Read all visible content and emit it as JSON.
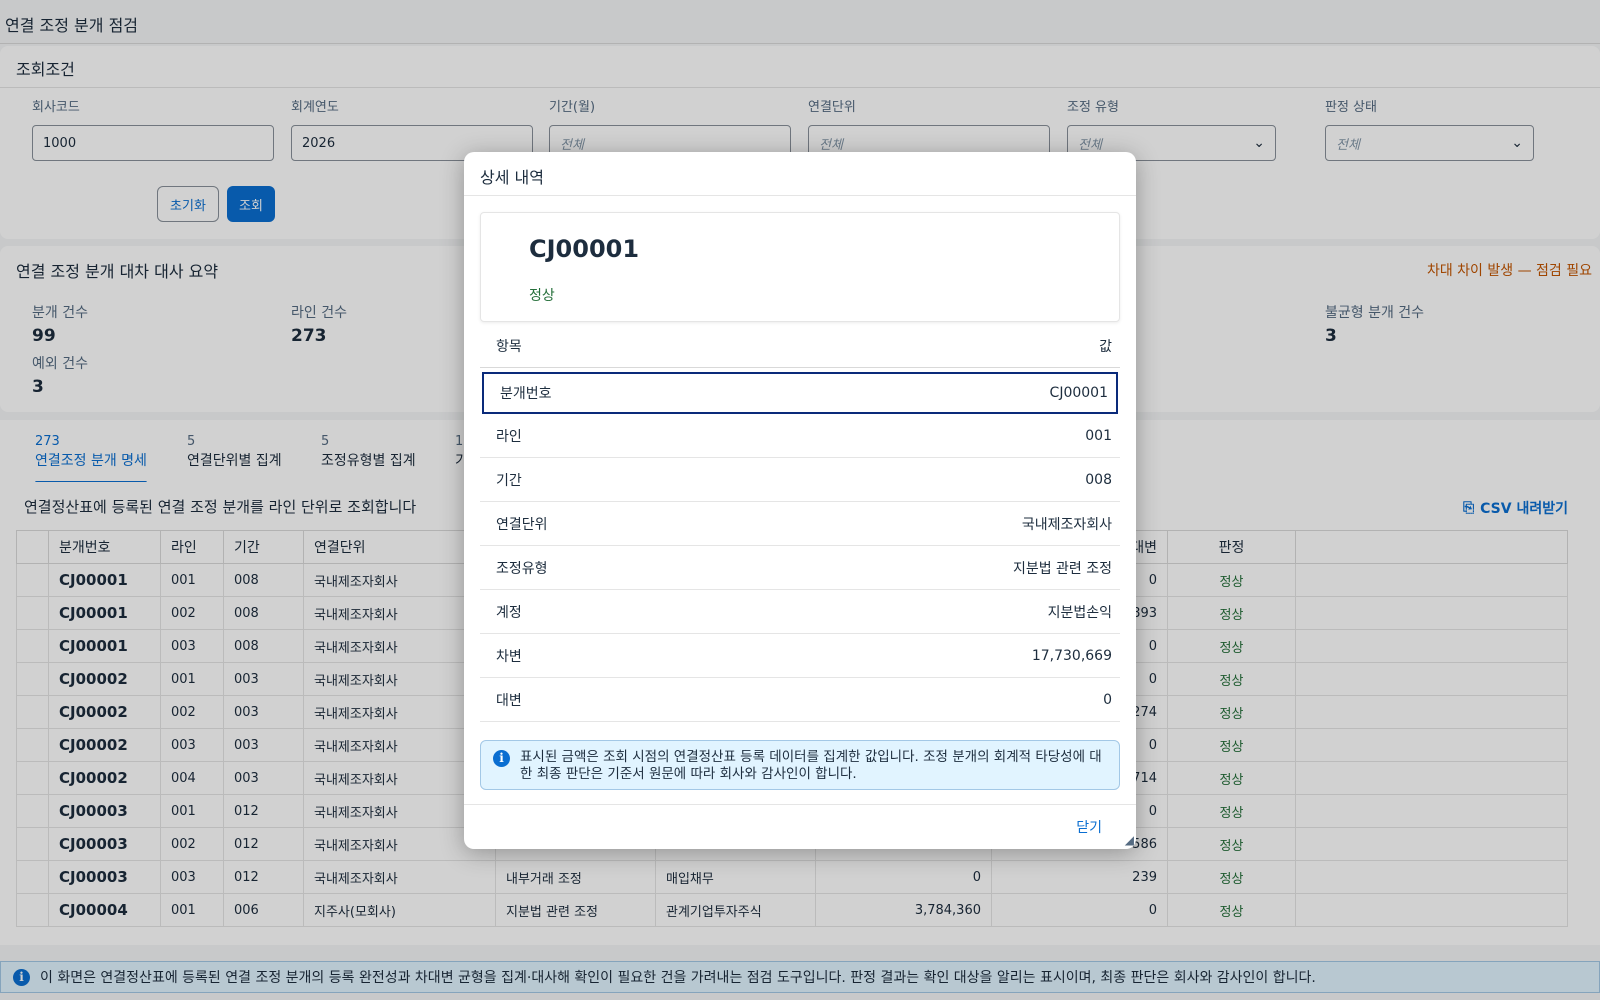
{
  "page": {
    "title": "연결 조정 분개 점검"
  },
  "filters": {
    "header": "조회조건",
    "fields": [
      {
        "label": "회사코드",
        "value": "1000",
        "placeholder": ""
      },
      {
        "label": "회계연도",
        "value": "2026",
        "placeholder": ""
      },
      {
        "label": "기간(월)",
        "value": "",
        "placeholder": "전체"
      },
      {
        "label": "연결단위",
        "value": "",
        "placeholder": "전체"
      },
      {
        "label": "조정 유형",
        "value": "",
        "placeholder": "전체"
      },
      {
        "label": "판정 상태",
        "value": "",
        "placeholder": "전체"
      }
    ],
    "reset_label": "초기화",
    "search_label": "조회"
  },
  "summary": {
    "title": "연결 조정 분개 대차 대사 요약",
    "warning": "차대 차이 발생 — 점검 필요",
    "stats": [
      {
        "label": "분개 건수",
        "value": "99"
      },
      {
        "label": "라인 건수",
        "value": "273"
      },
      {
        "label": "불균형 분개 건수",
        "value": "3"
      },
      {
        "label": "예외 건수",
        "value": "3"
      }
    ]
  },
  "tabs": [
    {
      "count": "273",
      "label": "연결조정 분개 명세"
    },
    {
      "count": "5",
      "label": "연결단위별 집계"
    },
    {
      "count": "5",
      "label": "조정유형별 집계"
    },
    {
      "count": "1",
      "label": "기"
    }
  ],
  "table": {
    "caption": "연결정산표에 등록된 연결 조정 분개를 라인 단위로 조회합니다",
    "csv_label": "CSV 내려받기",
    "columns": [
      "분개번호",
      "라인",
      "기간",
      "연결단위",
      "",
      "",
      "",
      "대변",
      "판정"
    ],
    "rows": [
      [
        "CJ00001",
        "001",
        "008",
        "국내제조자회사",
        "",
        "",
        "",
        "0",
        "정상"
      ],
      [
        "CJ00001",
        "002",
        "008",
        "국내제조자회사",
        "",
        "",
        "",
        "893",
        "정상"
      ],
      [
        "CJ00001",
        "003",
        "008",
        "국내제조자회사",
        "",
        "",
        "",
        "0",
        "정상"
      ],
      [
        "CJ00002",
        "001",
        "003",
        "국내제조자회사",
        "",
        "",
        "",
        "0",
        "정상"
      ],
      [
        "CJ00002",
        "002",
        "003",
        "국내제조자회사",
        "",
        "",
        "",
        "274",
        "정상"
      ],
      [
        "CJ00002",
        "003",
        "003",
        "국내제조자회사",
        "",
        "",
        "",
        "0",
        "정상"
      ],
      [
        "CJ00002",
        "004",
        "003",
        "국내제조자회사",
        "",
        "",
        "",
        "714",
        "정상"
      ],
      [
        "CJ00003",
        "001",
        "012",
        "국내제조자회사",
        "",
        "",
        "",
        "0",
        "정상"
      ],
      [
        "CJ00003",
        "002",
        "012",
        "국내제조자회사",
        "",
        "",
        "",
        "586",
        "정상"
      ],
      [
        "CJ00003",
        "003",
        "012",
        "국내제조자회사",
        "내부거래 조정",
        "매입채무",
        "0",
        "239",
        "정상"
      ],
      [
        "CJ00004",
        "001",
        "006",
        "지주사(모회사)",
        "지분법 관련 조정",
        "관계기업투자주식",
        "3,784,360",
        "0",
        "정상"
      ]
    ]
  },
  "footer": {
    "notice": "이 화면은 연결정산표에 등록된 연결 조정 분개의 등록 완전성과 차대변 균형을 집계·대사해 확인이 필요한 건을 가려내는 점검 도구입니다. 판정 결과는 확인 대상을 알리는 표시이며, 최종 판단은 회사와 감사인이 합니다."
  },
  "dialog": {
    "title": "상세 내역",
    "doc_no": "CJ00001",
    "status": "정상",
    "head": {
      "key": "항목",
      "value": "값"
    },
    "rows": [
      {
        "key": "분개번호",
        "value": "CJ00001"
      },
      {
        "key": "라인",
        "value": "001"
      },
      {
        "key": "기간",
        "value": "008"
      },
      {
        "key": "연결단위",
        "value": "국내제조자회사"
      },
      {
        "key": "조정유형",
        "value": "지분법 관련 조정"
      },
      {
        "key": "계정",
        "value": "지분법손익"
      },
      {
        "key": "차변",
        "value": "17,730,669"
      },
      {
        "key": "대변",
        "value": "0"
      }
    ],
    "note": "표시된 금액은 조회 시점의 연결정산표 등록 데이터를 집계한 값입니다. 조정 분개의 회계적 타당성에 대한 최종 판단은 기준서 원문에 따라 회사와 감사인이 합니다.",
    "close_label": "닫기"
  },
  "colors": {
    "accent": "#0a6ed1",
    "positive": "#256f3a",
    "warning": "#c35500",
    "info_bg": "#e1f4ff"
  }
}
